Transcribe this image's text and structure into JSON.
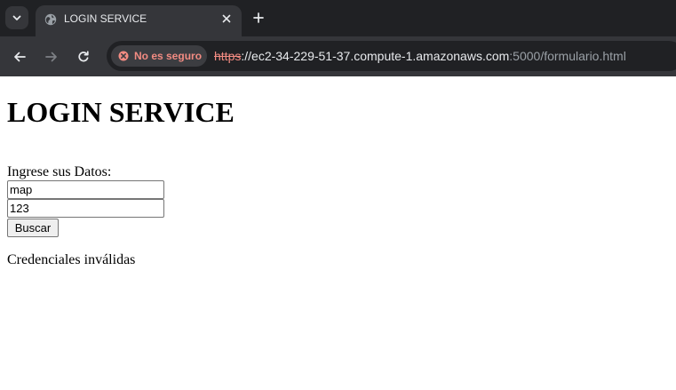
{
  "browser": {
    "tab": {
      "title": "LOGIN SERVICE"
    },
    "security": {
      "label": "No es seguro",
      "color": "#f28b82"
    },
    "url": {
      "scheme": "https",
      "host": "://ec2-34-229-51-37.compute-1.amazonaws.com",
      "path": ":5000/formulario.html"
    },
    "icons": {
      "tab_search": "chevron-down-icon",
      "favicon": "globe-icon",
      "tab_close": "close-icon",
      "new_tab": "plus-icon",
      "back": "back-arrow-icon",
      "forward": "forward-arrow-icon",
      "reload": "reload-icon",
      "security": "not-secure-icon"
    }
  },
  "page": {
    "title": "LOGIN SERVICE",
    "form": {
      "label": "Ingrese sus Datos:",
      "username_value": "map",
      "password_value": "123",
      "submit_label": "Buscar"
    },
    "message": "Credenciales inválidas"
  }
}
